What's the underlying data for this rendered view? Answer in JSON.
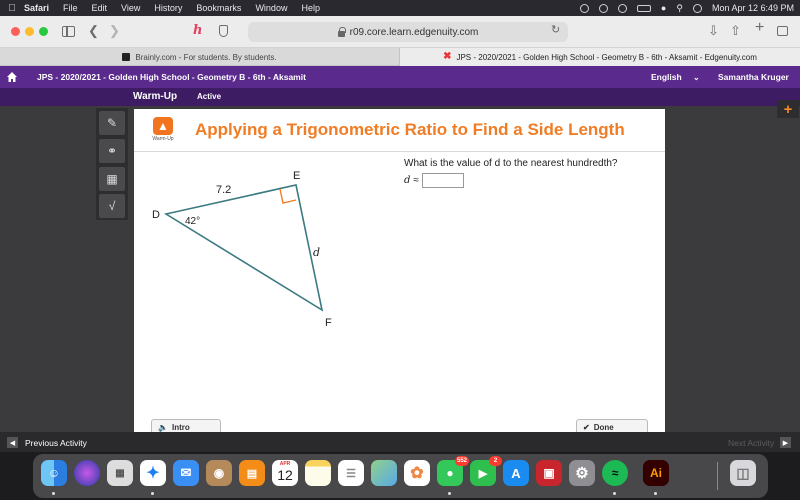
{
  "menubar": {
    "app_name": "Safari",
    "items": [
      "File",
      "Edit",
      "View",
      "History",
      "Bookmarks",
      "Window",
      "Help"
    ],
    "datetime": "Mon Apr 12  6:49 PM"
  },
  "toolbar": {
    "url": "r09.core.learn.edgenuity.com"
  },
  "tabs": [
    {
      "title": "Brainly.com - For students. By students."
    },
    {
      "title": "JPS - 2020/2021 - Golden High School - Geometry B - 6th - Aksamit - Edgenuity.com"
    }
  ],
  "header": {
    "course": "JPS - 2020/2021 - Golden High School - Geometry B - 6th - Aksamit",
    "language": "English",
    "user": "Samantha Kruger",
    "lesson_type": "Warm-Up",
    "status": "Active"
  },
  "activity": {
    "logo_label": "Warm-Up",
    "title": "Applying a Trigonometric Ratio to Find a Side Length",
    "question": "What is the value of d to the nearest hundredth?",
    "answer_var": "d",
    "approx": "≈",
    "answer_value": ""
  },
  "diagram": {
    "vertex_d": "D",
    "vertex_e": "E",
    "vertex_f": "F",
    "side_de": "7.2",
    "side_ef": "d",
    "angle_d": "42°"
  },
  "buttons": {
    "intro": "Intro",
    "done": "Done"
  },
  "footer": {
    "previous": "Previous Activity",
    "next": "Next Activity"
  },
  "dock": {
    "calendar_month": "APR",
    "calendar_day": "12",
    "messages_badge": "552",
    "facetime_badge": "2",
    "apps": [
      "Finder",
      "Siri",
      "Launchpad",
      "Safari",
      "Mail",
      "Contacts",
      "Books",
      "Calendar",
      "Notes",
      "Reminders",
      "Maps",
      "Photos",
      "Messages",
      "FaceTime",
      "App Store",
      "Photo Booth",
      "System Preferences",
      "Spotify",
      "Adobe Illustrator",
      "Trash"
    ],
    "illustrator_label": "Ai"
  }
}
